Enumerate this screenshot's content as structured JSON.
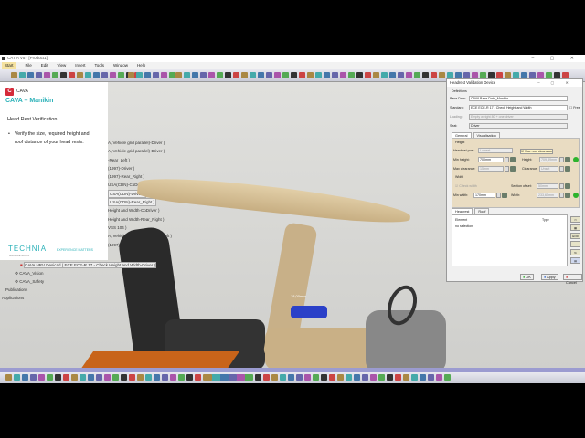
{
  "window": {
    "title": "CATIA V5 - [Product1]",
    "controls": "– ▢ ✕"
  },
  "menu": [
    "Start",
    "File",
    "Edit",
    "View",
    "Insert",
    "Tools",
    "Window",
    "Help"
  ],
  "left_panel": {
    "brand_small": "CAVA",
    "title": "CAVA – Manikin",
    "section": "Head Rest Verification",
    "bullet_line1": "Verify the size, required height and",
    "bullet_line2": "roof distance of your head rests.",
    "company": "TECHNIA",
    "company_sub": "ADDNODE GROUP",
    "tagline": "EXPERIENCE MATTERS"
  },
  "tree": [
    "A, Vehicle grid parallel)-Driver )",
    "A, Vehicle grid parallel)-Driver )",
    "-Rear_Left )",
    "(1997)-Driver )",
    "(1997)-Rear_Right )",
    "USA(CDN)-CoDriver )",
    "USA(CDN)-Driver )",
    "USA(CDN)-Rear_Right )",
    "Height and Width-CoDriver )",
    "Height and Width-Rear_Right )",
    "",
    "VSS 104 )",
    "A, Vehicle grid parallel)-Rear_Left )",
    "(1997)-Rear_Right )"
  ],
  "tree_bottom": [
    "CAVA HRV Desicad ( ECE ECE-R 17 - Check Height and Width-Driver )",
    "CAVA_Vision",
    "CAVA_Safety",
    "Publications",
    "Applications"
  ],
  "viewport": {
    "dimension_label": "18,00mm"
  },
  "dialog": {
    "title": "Headrest Validation Device",
    "definitions_label": "Definitions",
    "base_data_label": "Base Data:",
    "base_data_value": "CAVA Base Data_Manikin",
    "standard_label": "Standard:",
    "standard_value": "ECE ECE-R 17 - Check Height and Width",
    "free_label": "Free",
    "loading_label": "Loading:",
    "loading_value": "Empty weight 80 + one driver",
    "seat_label": "Seat:",
    "seat_value": "Driver",
    "tabs": [
      "General",
      "Visualisation"
    ],
    "height_label": "Height",
    "headrest_pos_label": "Headrest pos.:",
    "headrest_pos_value": "Lowest",
    "use_roof_label": "Use roof clearance",
    "min_height_label": "Min height:",
    "min_height_value": "700mm",
    "height_label2": "Height:",
    "height_value": "709,89mm",
    "max_clearance_label": "Max clearance:",
    "max_clearance_value": "15mm",
    "clearance_label": "Clearance:",
    "clearance_value": "Unset",
    "width_label": "Width",
    "check_width_label": "Check width",
    "section_offset_label": "Section offset:",
    "section_offset_value": "50mm",
    "min_width_label": "Min width:",
    "min_width_value": "170mm",
    "width_label2": "Width:",
    "width_value": "233,65mm",
    "list_tabs": [
      "Headrest",
      "Roof"
    ],
    "col_element": "Element",
    "col_type": "Type",
    "no_selection": "no selection",
    "side_buttons": [
      "▭",
      "▦",
      "EOR",
      "—",
      "%",
      "▤"
    ],
    "ok": "OK",
    "apply": "Apply",
    "cancel": "Cancel"
  },
  "colors": {
    "accent": "#2bb1b8",
    "brand_red": "#d52b3a",
    "ok_green": "#2db32d"
  }
}
